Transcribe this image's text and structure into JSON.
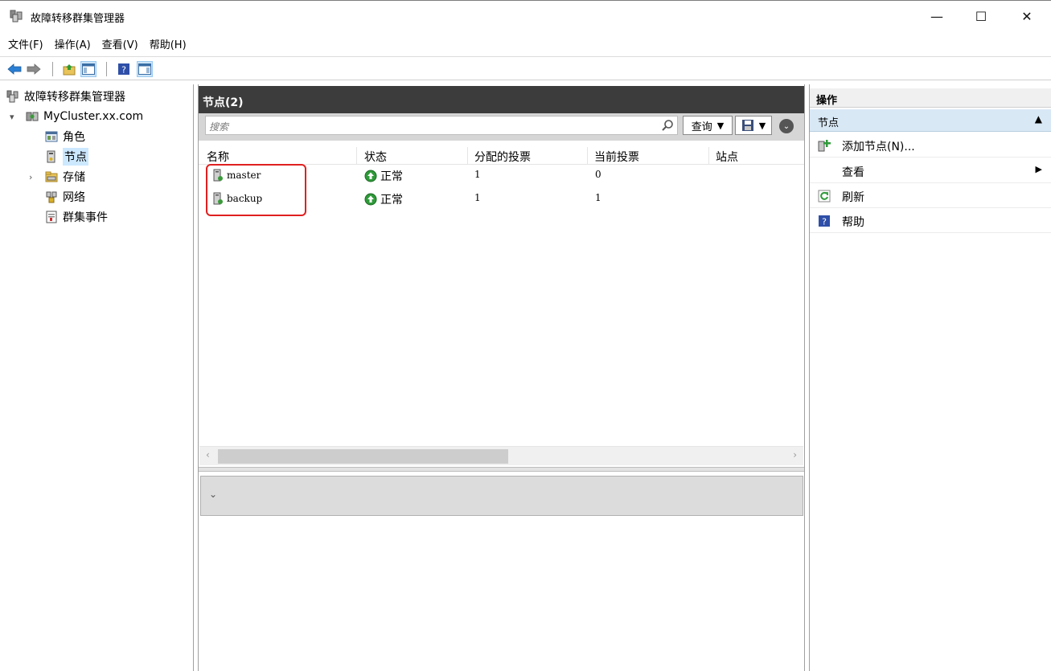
{
  "window": {
    "title": "故障转移群集管理器",
    "min": "—",
    "max": "☐",
    "close": "✕"
  },
  "menu": [
    {
      "label": "文件(F)"
    },
    {
      "label": "操作(A)"
    },
    {
      "label": "查看(V)"
    },
    {
      "label": "帮助(H)"
    }
  ],
  "tree": {
    "root": "故障转移群集管理器",
    "cluster": "MyCluster.xx.com",
    "items": [
      "角色",
      "节点",
      "存储",
      "网络",
      "群集事件"
    ],
    "selected": "节点"
  },
  "center": {
    "title": "节点(2)",
    "search_placeholder": "搜索",
    "query_label": "查询",
    "columns": [
      "名称",
      "状态",
      "分配的投票",
      "当前投票",
      "站点"
    ],
    "rows": [
      {
        "name": "master",
        "status": "正常",
        "assigned": "1",
        "current": "0",
        "site": ""
      },
      {
        "name": "backup",
        "status": "正常",
        "assigned": "1",
        "current": "1",
        "site": ""
      }
    ],
    "highlight_color": "#e02020"
  },
  "actions": {
    "header": "操作",
    "section": "节点",
    "items": [
      {
        "label": "添加节点(N)...",
        "icon": "add-node-icon"
      },
      {
        "label": "查看",
        "icon": "",
        "submenu": true
      },
      {
        "label": "刷新",
        "icon": "refresh-icon"
      },
      {
        "label": "帮助",
        "icon": "help-icon"
      }
    ]
  },
  "colors": {
    "header_dark": "#3c3c3c",
    "selection": "#cce8ff",
    "actions_section": "#d9e8f5"
  }
}
